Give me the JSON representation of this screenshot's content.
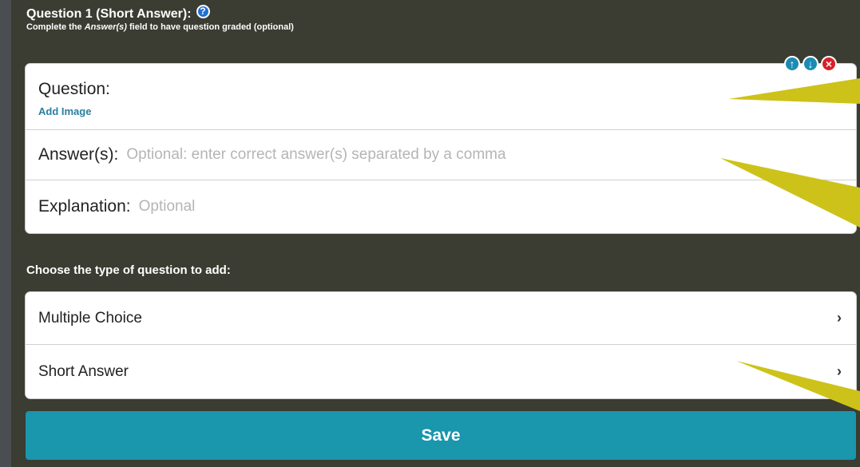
{
  "question": {
    "title": "Question 1 (Short Answer):",
    "help_icon": "question-circle-icon",
    "subtitle_prefix": "Complete the ",
    "subtitle_emphasis": "Answer(s)",
    "subtitle_suffix": " field to have question graded (optional)",
    "controls": {
      "up_icon": "arrow-up-circle-icon",
      "down_icon": "arrow-down-circle-icon",
      "delete_icon": "close-circle-icon"
    },
    "fields": {
      "question_label": "Question:",
      "add_image": "Add Image",
      "answers_label": "Answer(s):",
      "answers_placeholder": "Optional: enter correct answer(s) separated by a comma",
      "explanation_label": "Explanation:",
      "explanation_placeholder": "Optional"
    }
  },
  "types": {
    "title": "Choose the type of question to add:",
    "options": [
      {
        "label": "Multiple Choice"
      },
      {
        "label": "Short Answer"
      }
    ]
  },
  "save_label": "Save",
  "colors": {
    "panel_bg": "#3b3c32",
    "save_button": "#1a96ad",
    "link": "#2a7ea0",
    "callout": "#cdc21a",
    "delete": "#d9202a"
  }
}
